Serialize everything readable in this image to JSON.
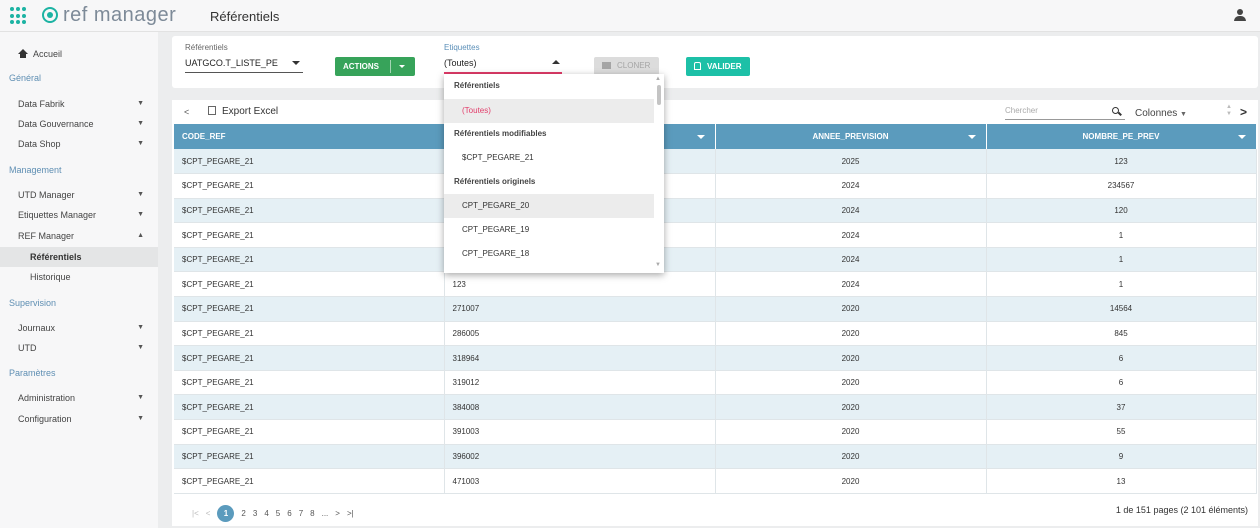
{
  "header": {
    "app_name": "ref manager",
    "page_title": "Référentiels"
  },
  "sidebar": {
    "items": [
      {
        "label": "Accueil",
        "type": "home"
      },
      {
        "label": "Général",
        "type": "section"
      },
      {
        "label": "Data Fabrik",
        "type": "item",
        "chevron": "▼"
      },
      {
        "label": "Data Gouvernance",
        "type": "item",
        "chevron": "▼"
      },
      {
        "label": "Data Shop",
        "type": "item",
        "chevron": "▼"
      },
      {
        "label": "Management",
        "type": "section"
      },
      {
        "label": "UTD Manager",
        "type": "item",
        "chevron": "▼"
      },
      {
        "label": "Etiquettes Manager",
        "type": "item",
        "chevron": "▼"
      },
      {
        "label": "REF Manager",
        "type": "item",
        "chevron": "▲"
      },
      {
        "label": "Référentiels",
        "type": "sub",
        "active": true
      },
      {
        "label": "Historique",
        "type": "sub"
      },
      {
        "label": "Supervision",
        "type": "section"
      },
      {
        "label": "Journaux",
        "type": "item",
        "chevron": "▼"
      },
      {
        "label": "UTD",
        "type": "item",
        "chevron": "▼"
      },
      {
        "label": "Paramètres",
        "type": "section"
      },
      {
        "label": "Administration",
        "type": "item",
        "chevron": "▼"
      },
      {
        "label": "Configuration",
        "type": "item",
        "chevron": "▼"
      }
    ]
  },
  "filters": {
    "referentiels_label": "Référentiels",
    "referentiels_value": "UATGCO.T_LISTE_PE",
    "actions_label": "ACTIONS",
    "etiquettes_label": "Etiquettes",
    "etiquettes_value": "(Toutes)",
    "cloner_label": "CLONER",
    "valider_label": "VALIDER"
  },
  "toolbar": {
    "export_label": "Export Excel",
    "search_placeholder": "Chercher",
    "colonnes_label": "Colonnes"
  },
  "table": {
    "columns": [
      "CODE_REF",
      "",
      "ANNEE_PREVISION",
      "NOMBRE_PE_PREV"
    ],
    "rows": [
      [
        "$CPT_PEGARE_21",
        "",
        "2025",
        "123"
      ],
      [
        "$CPT_PEGARE_21",
        "",
        "2024",
        "234567"
      ],
      [
        "$CPT_PEGARE_21",
        "",
        "2024",
        "120"
      ],
      [
        "$CPT_PEGARE_21",
        "",
        "2024",
        "1"
      ],
      [
        "$CPT_PEGARE_21",
        "",
        "2024",
        "1"
      ],
      [
        "$CPT_PEGARE_21",
        "123",
        "2024",
        "1"
      ],
      [
        "$CPT_PEGARE_21",
        "271007",
        "2020",
        "14564"
      ],
      [
        "$CPT_PEGARE_21",
        "286005",
        "2020",
        "845"
      ],
      [
        "$CPT_PEGARE_21",
        "318964",
        "2020",
        "6"
      ],
      [
        "$CPT_PEGARE_21",
        "319012",
        "2020",
        "6"
      ],
      [
        "$CPT_PEGARE_21",
        "384008",
        "2020",
        "37"
      ],
      [
        "$CPT_PEGARE_21",
        "391003",
        "2020",
        "55"
      ],
      [
        "$CPT_PEGARE_21",
        "396002",
        "2020",
        "9"
      ],
      [
        "$CPT_PEGARE_21",
        "471003",
        "2020",
        "13"
      ]
    ]
  },
  "dropdown": {
    "items": [
      {
        "label": "Référentiels",
        "type": "group"
      },
      {
        "label": "(Toutes)",
        "type": "option",
        "selected": true,
        "highlighted": true
      },
      {
        "label": "Référentiels modifiables",
        "type": "group"
      },
      {
        "label": "$CPT_PEGARE_21",
        "type": "option"
      },
      {
        "label": "Référentiels originels",
        "type": "group"
      },
      {
        "label": "CPT_PEGARE_20",
        "type": "option",
        "highlighted": true
      },
      {
        "label": "CPT_PEGARE_19",
        "type": "option"
      },
      {
        "label": "CPT_PEGARE_18",
        "type": "option"
      }
    ]
  },
  "pagination": {
    "first": "|<",
    "prev": "<",
    "pages": [
      "1",
      "2",
      "3",
      "4",
      "5",
      "6",
      "7",
      "8",
      "..."
    ],
    "current": "1",
    "next": ">",
    "last": ">|",
    "info": "1 de 151 pages (2 101 éléments)"
  },
  "colors": {
    "accent": "#1cb3a3",
    "header_blue": "#5b9bbd",
    "actions_green": "#37a35a",
    "valider_teal": "#1dc0a7",
    "selection_pink": "#e23c6a"
  }
}
